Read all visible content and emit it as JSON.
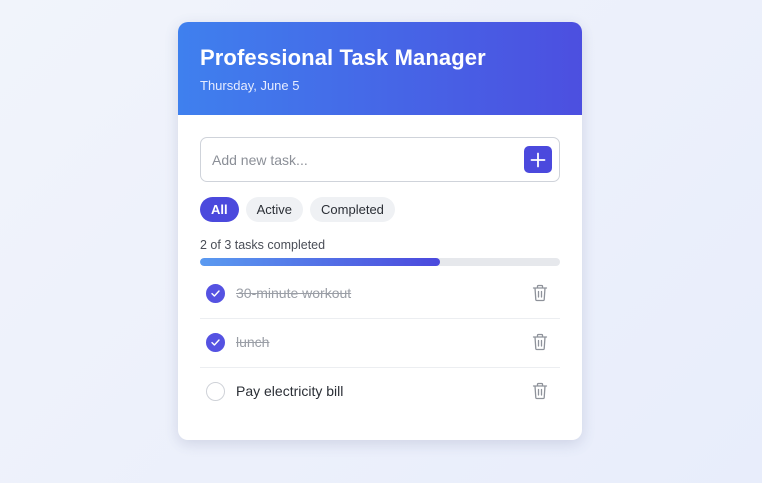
{
  "header": {
    "title": "Professional Task Manager",
    "date": "Thursday, June 5"
  },
  "add_task": {
    "placeholder": "Add new task...",
    "value": "",
    "button_icon": "plus-icon"
  },
  "filters": [
    {
      "label": "All",
      "active": true
    },
    {
      "label": "Active",
      "active": false
    },
    {
      "label": "Completed",
      "active": false
    }
  ],
  "progress": {
    "label": "2 of 3 tasks completed",
    "completed": 2,
    "total": 3
  },
  "tasks": [
    {
      "text": "30-minute workout",
      "completed": true
    },
    {
      "text": "lunch",
      "completed": true
    },
    {
      "text": "Pay electricity bill",
      "completed": false
    }
  ],
  "colors": {
    "accent": "#4b49dd",
    "header_start": "#3f80ee",
    "header_end": "#4c4fe0"
  },
  "icons": {
    "check": "check-icon",
    "delete": "trash-icon"
  }
}
